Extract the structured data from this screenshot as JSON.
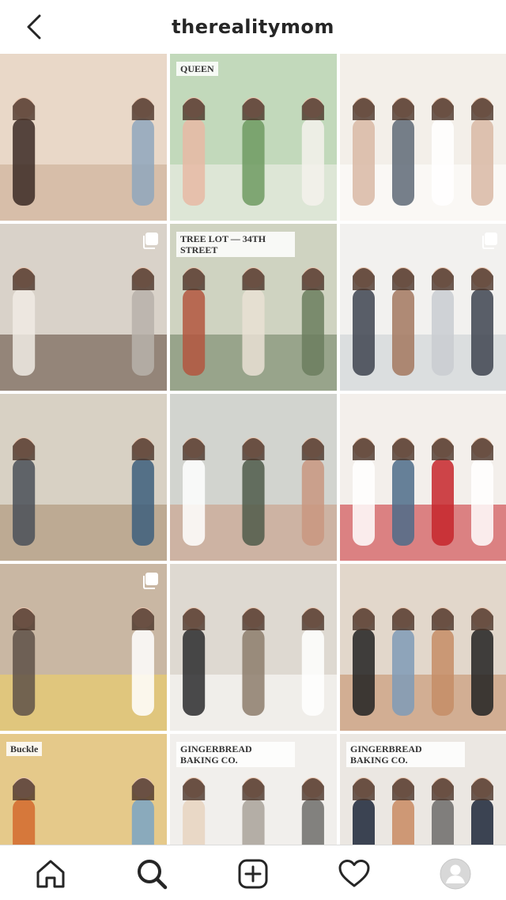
{
  "header": {
    "username": "therealitymom",
    "back_icon": "chevron-left-icon"
  },
  "grid": {
    "posts": [
      {
        "name": "post-girls-fringe-tops",
        "carousel": false,
        "palette": [
          "#e9d8c8",
          "#c9a98f",
          "#3b2a24",
          "#8fa7bd"
        ],
        "text": ""
      },
      {
        "name": "post-queen-mug",
        "carousel": false,
        "palette": [
          "#c2d9bb",
          "#f4f1ec",
          "#e8b9a4",
          "#6e9a62"
        ],
        "text": "QUEEN"
      },
      {
        "name": "post-three-kids",
        "carousel": false,
        "palette": [
          "#f3efe9",
          "#ffffff",
          "#d8b9a5",
          "#5e6a77"
        ],
        "text": ""
      },
      {
        "name": "post-kitchen-baking",
        "carousel": true,
        "palette": [
          "#d9d2c9",
          "#5b4636",
          "#f0ebe4",
          "#b7b1aa"
        ],
        "text": ""
      },
      {
        "name": "post-garden-nursery",
        "carousel": false,
        "palette": [
          "#cfd3c1",
          "#6b7e5e",
          "#b3563e",
          "#e9e1d3"
        ],
        "text": "TREE LOT — 34TH STREET"
      },
      {
        "name": "post-white-kitchen-group",
        "carousel": true,
        "palette": [
          "#f2f1ef",
          "#c9cdd1",
          "#3e4450",
          "#a3785f"
        ],
        "text": ""
      },
      {
        "name": "post-mom-two-boys",
        "carousel": false,
        "palette": [
          "#d8d1c4",
          "#a88a6b",
          "#4a5058",
          "#3d5f7d"
        ],
        "text": ""
      },
      {
        "name": "post-bridesmaids",
        "carousel": false,
        "palette": [
          "#d2d4cf",
          "#c99780",
          "#ffffff",
          "#4f5b4a"
        ],
        "text": ""
      },
      {
        "name": "post-santa-kids",
        "carousel": false,
        "palette": [
          "#f3efeb",
          "#c6262b",
          "#ffffff",
          "#4c6c8a"
        ],
        "text": ""
      },
      {
        "name": "post-door-shopping-bags",
        "carousel": true,
        "palette": [
          "#c9b7a3",
          "#f2d35f",
          "#5e5148",
          "#ffffff"
        ],
        "text": ""
      },
      {
        "name": "post-christmas-tree-dog",
        "carousel": false,
        "palette": [
          "#ded9d1",
          "#ffffff",
          "#2b2b2e",
          "#8d7d6c"
        ],
        "text": ""
      },
      {
        "name": "post-four-women",
        "carousel": false,
        "palette": [
          "#e2d7cb",
          "#c58d66",
          "#222222",
          "#7f9bb7"
        ],
        "text": ""
      },
      {
        "name": "post-mural-buckle",
        "carousel": false,
        "palette": [
          "#e5c98a",
          "#2f2b29",
          "#d36a2d",
          "#7aa5c4"
        ],
        "text": "Buckle"
      },
      {
        "name": "post-living-room-tree",
        "carousel": false,
        "palette": [
          "#f1efec",
          "#6f6d6b",
          "#e8d3c0",
          "#a9a29a"
        ],
        "text": "GINGERBREAD BAKING CO."
      },
      {
        "name": "post-living-room-tv",
        "carousel": false,
        "palette": [
          "#ebe7e2",
          "#6d6b6a",
          "#1c2638",
          "#c98a62"
        ],
        "text": "GINGERBREAD BAKING CO."
      }
    ]
  },
  "tabbar": {
    "items": [
      {
        "name": "home",
        "icon": "home-icon"
      },
      {
        "name": "search",
        "icon": "search-icon"
      },
      {
        "name": "new-post",
        "icon": "add-post-icon"
      },
      {
        "name": "activity",
        "icon": "heart-icon"
      },
      {
        "name": "profile",
        "icon": "profile-avatar-icon"
      }
    ],
    "active": "search"
  }
}
